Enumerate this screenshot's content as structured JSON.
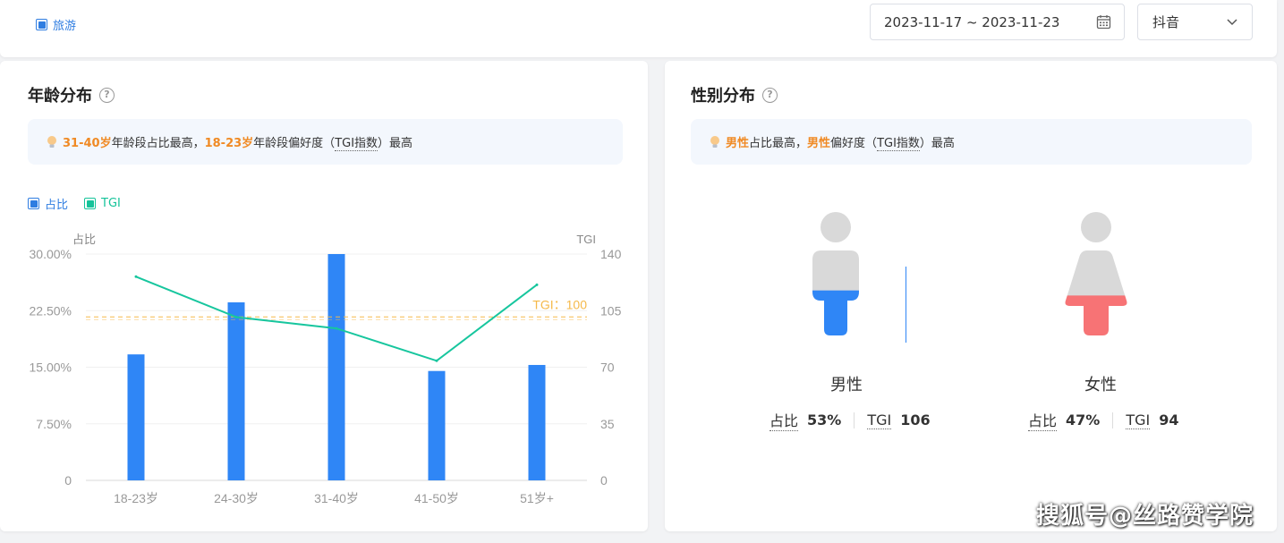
{
  "filters": {
    "category_tag": "旅游",
    "date_range": "2023-11-17 ~ 2023-11-23",
    "platform": "抖音"
  },
  "age_card": {
    "title": "年龄分布",
    "insight": {
      "range1": "31-40岁",
      "text1": "年龄段占比最高，",
      "range2": "18-23岁",
      "text2": "年龄段偏好度（",
      "tgi": "TGI指数",
      "text3": "）最高"
    },
    "legend": {
      "share": "占比",
      "tgi": "TGI"
    },
    "axis_left_title": "占比",
    "axis_right_title": "TGI",
    "tgi_baseline_label": "TGI：100"
  },
  "chart_data": {
    "type": "bar",
    "categories": [
      "18-23岁",
      "24-30岁",
      "31-40岁",
      "41-50岁",
      "51岁+"
    ],
    "series": [
      {
        "name": "占比",
        "type": "bar",
        "axis": "left",
        "values": [
          16.7,
          23.6,
          30.0,
          14.5,
          15.3
        ]
      },
      {
        "name": "TGI",
        "type": "line",
        "axis": "right",
        "values": [
          126,
          101,
          94,
          74,
          121
        ]
      }
    ],
    "y_left": {
      "label": "占比",
      "ylim": [
        0,
        30
      ],
      "ticks": [
        "0",
        "7.50%",
        "15.00%",
        "22.50%",
        "30.00%"
      ]
    },
    "y_right": {
      "label": "TGI",
      "ylim": [
        0,
        140
      ],
      "ticks": [
        "0",
        "35",
        "70",
        "105",
        "140"
      ]
    },
    "baseline": {
      "label": "TGI：100",
      "value": 100
    },
    "colors": {
      "bar": "#2f86f6",
      "line": "#17c69e",
      "baseline": "#f5b94a"
    },
    "grid": true,
    "legend_position": "top-left"
  },
  "gender_card": {
    "title": "性别分布",
    "insight": {
      "hl1": "男性",
      "text1": "占比最高，",
      "hl2": "男性",
      "text2": "偏好度（",
      "tgi": "TGI指数",
      "text3": "）最高"
    },
    "male": {
      "label": "男性",
      "share_label": "占比",
      "share": "53%",
      "tgi_label": "TGI",
      "tgi": "106",
      "fill_fraction": 0.53,
      "color": "#2f86f6"
    },
    "female": {
      "label": "女性",
      "share_label": "占比",
      "share": "47%",
      "tgi_label": "TGI",
      "tgi": "94",
      "fill_fraction": 0.47,
      "color": "#f77375"
    }
  },
  "watermark": "搜狐号@丝路赞学院",
  "icons": {
    "calendar": "calendar-icon",
    "chevron": "chevron-down-icon",
    "help": "help-circle-icon",
    "bulb": "lightbulb-icon"
  }
}
